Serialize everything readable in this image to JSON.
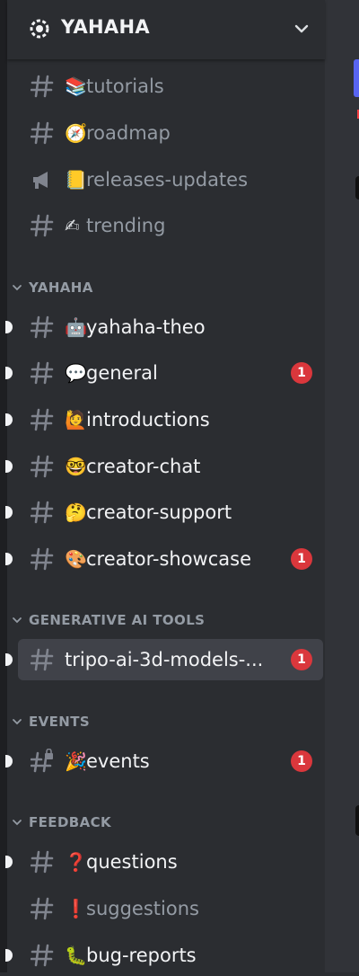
{
  "server": {
    "name": "YAHAHA"
  },
  "channels_top": [
    {
      "icon": "hash-icon",
      "emoji": "📚",
      "label": "tutorials",
      "muted": true
    },
    {
      "icon": "hash-icon",
      "emoji": "🧭",
      "label": "roadmap",
      "muted": true
    },
    {
      "icon": "megaphone-icon",
      "emoji": "📒",
      "label": "releases-updates",
      "muted": true
    },
    {
      "icon": "hash-icon",
      "emoji": "✍",
      "label": "trending",
      "muted": true
    }
  ],
  "categories": [
    {
      "name": "YAHAHA",
      "channels": [
        {
          "emoji": "🤖",
          "label": "yahaha-theo",
          "badge": ""
        },
        {
          "emoji": "💬",
          "label": "general",
          "badge": "1"
        },
        {
          "emoji": "🙋",
          "label": "introductions",
          "badge": ""
        },
        {
          "emoji": "🤓",
          "label": "creator-chat",
          "badge": ""
        },
        {
          "emoji": "🤔",
          "label": "creator-support",
          "badge": ""
        },
        {
          "emoji": "🎨",
          "label": "creator-showcase",
          "badge": "1"
        }
      ]
    },
    {
      "name": "GENERATIVE AI TOOLS",
      "channels": [
        {
          "emoji": "",
          "label": "tripo-ai-3d-models-...",
          "badge": "1",
          "active": true
        }
      ]
    },
    {
      "name": "EVENTS",
      "channels": [
        {
          "emoji": "🎉",
          "label": "events",
          "badge": "1",
          "locked": true
        }
      ]
    },
    {
      "name": "FEEDBACK",
      "channels": [
        {
          "emoji": "❓",
          "label": "questions",
          "badge": ""
        },
        {
          "emoji": "❗",
          "label": "suggestions",
          "badge": "",
          "muted": true
        },
        {
          "emoji": "🐛",
          "label": "bug-reports",
          "badge": ""
        }
      ]
    }
  ],
  "colors": {
    "sidebar": "#2b2d31",
    "active_row": "#404249",
    "badge": "#da373c",
    "muted_text": "#949ba4",
    "bright_text": "#f2f3f5",
    "accent": "#5865f2"
  }
}
